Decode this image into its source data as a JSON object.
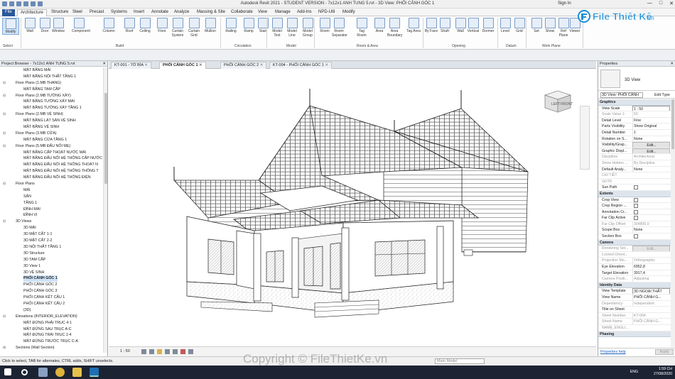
{
  "titlebar": {
    "title": "Autodesk Revit 2021 - STUDENT VERSION - 7x12x1 ANH TUNG 5.rvt - 3D View: PHỐI CẢNH GÓC 1",
    "sign_in": "Sign In"
  },
  "ribbon_tabs": [
    "File",
    "Architecture",
    "Structure",
    "Steel",
    "Precast",
    "Systems",
    "Insert",
    "Annotate",
    "Analyze",
    "Massing & Site",
    "Collaborate",
    "View",
    "Manage",
    "Add-Ins",
    "NPD-Util",
    "Modify"
  ],
  "ribbon": {
    "buttons": [
      "Modify",
      "Wall",
      "Door",
      "Window",
      "Component",
      "Column",
      "Roof",
      "Ceiling",
      "Floor",
      "Curtain System",
      "Curtain Grid",
      "Mullion",
      "Railing",
      "Ramp",
      "Stair",
      "Model Text",
      "Model Line",
      "Model Group",
      "Room",
      "Room Separator",
      "Tag Room",
      "Area",
      "Area Boundary",
      "Tag Area",
      "By Face",
      "Shaft",
      "Wall",
      "Vertical",
      "Dormer",
      "Level",
      "Grid",
      "Set",
      "Show",
      "Ref Plane",
      "Viewer"
    ],
    "groups": [
      "Select",
      "Build",
      "Circulation",
      "Model",
      "Room & Area",
      "Opening",
      "Datum",
      "Work Plane"
    ]
  },
  "project_browser": {
    "title": "Project Browser - 7x12x1 ANH TUNG 5.rvt",
    "items": [
      {
        "label": "MẶT BẰNG MÁI",
        "level": 2
      },
      {
        "label": "MẶT BẰNG NỘI THẤT TẦNG 1",
        "level": 2
      },
      {
        "label": "Floor Plans (1.MB THANG)",
        "level": 1,
        "toggle": "⊟"
      },
      {
        "label": "MẶT BẰNG TAM CẤP",
        "level": 2
      },
      {
        "label": "Floor Plans (2.MB TƯỜNG XÂY)",
        "level": 1,
        "toggle": "⊟"
      },
      {
        "label": "MẶT BẰNG TƯỜNG XÂY MÁI",
        "level": 2
      },
      {
        "label": "MẶT BẰNG TƯỜNG XÂY TẦNG 1",
        "level": 2
      },
      {
        "label": "Floor Plans (2.MB VỆ SINH)",
        "level": 1,
        "toggle": "⊟"
      },
      {
        "label": "MẶT BẰNG LÁT SÀN VỆ SINH",
        "level": 2
      },
      {
        "label": "MẶT BẰNG VỆ SINH",
        "level": 2
      },
      {
        "label": "Floor Plans (3.MB CỬA)",
        "level": 1,
        "toggle": "⊟"
      },
      {
        "label": "MẶT BẰNG CỬA TẦNG 1",
        "level": 2
      },
      {
        "label": "Floor Plans (5.MB ĐẤU NỐI ME)",
        "level": 1,
        "toggle": "⊟"
      },
      {
        "label": "MẶT BẰNG CẤP THOÁT NƯỚC MÁI",
        "level": 2
      },
      {
        "label": "MẶT BẰNG ĐẤU NỐI HỆ THỐNG CẤP NƯỚC",
        "level": 2
      },
      {
        "label": "MẶT BẰNG ĐẤU NỐI HỆ THỐNG THOÁT N",
        "level": 2
      },
      {
        "label": "MẶT BẰNG ĐẤU NỐI HỆ THỐNG THÔNG T",
        "level": 2
      },
      {
        "label": "MẶT BẰNG ĐẤU NỐI HỆ THỐNG ĐIỆN",
        "level": 2
      },
      {
        "label": "Floor Plans",
        "level": 1,
        "toggle": "⊟"
      },
      {
        "label": "MÁI",
        "level": 2
      },
      {
        "label": "SÂN",
        "level": 2
      },
      {
        "label": "TẦNG 1",
        "level": 2
      },
      {
        "label": "ĐỈNH MÁI",
        "level": 2
      },
      {
        "label": "ĐỈNH VỊ",
        "level": 2
      },
      {
        "label": "3D Views",
        "level": 1,
        "toggle": "⊟"
      },
      {
        "label": "3D MÁI",
        "level": 2
      },
      {
        "label": "3D MẶT CẮT 1-1",
        "level": 2
      },
      {
        "label": "3D MẶT CẮT 2-2",
        "level": 2
      },
      {
        "label": "3D NỘI THẤT TẦNG 1",
        "level": 2
      },
      {
        "label": "3D Structure",
        "level": 2
      },
      {
        "label": "3D TAM CẤP",
        "level": 2
      },
      {
        "label": "3D View 1",
        "level": 2
      },
      {
        "label": "3D VỆ SINH",
        "level": 2
      },
      {
        "label": "PHỐI CẢNH GÓC 1",
        "level": 2,
        "selected": true
      },
      {
        "label": "PHỐI CẢNH GÓC 2",
        "level": 2
      },
      {
        "label": "PHỐI CẢNH GÓC 3",
        "level": 2
      },
      {
        "label": "PHỐI CẢNH KẾT CẤU 1",
        "level": 2
      },
      {
        "label": "PHỐI CẢNH KẾT CẤU 2",
        "level": 2
      },
      {
        "label": "{3D}",
        "level": 2
      },
      {
        "label": "Elevations (INTERIOR_ELEVATION)",
        "level": 1,
        "toggle": "⊟"
      },
      {
        "label": "MẶT ĐỨNG PHẢI TRỤC 4-1",
        "level": 2
      },
      {
        "label": "MẶT ĐỨNG SAU TRỤC A-C",
        "level": 2
      },
      {
        "label": "MẶT ĐỨNG TRÁI TRỤC 1-4",
        "level": 2
      },
      {
        "label": "MẶT ĐỨNG TRƯỚC TRỤC C-A",
        "level": 2
      },
      {
        "label": "Sections (Wall Section)",
        "level": 1,
        "toggle": "⊞"
      }
    ]
  },
  "view_tabs": [
    {
      "label": "KT-001 - TỜ BÌA",
      "active": false
    },
    {
      "label": "PHỐI CẢNH GÓC 1",
      "active": true
    },
    {
      "label": "PHỐI CẢNH GÓC 2",
      "active": false
    },
    {
      "label": "KT-004 - PHỐI CẢNH GÓC 1",
      "active": false
    }
  ],
  "view_control": {
    "scale": "1 : 50"
  },
  "properties": {
    "title": "Properties",
    "type_name": "3D View",
    "selector": "3D View: PHỐI CẢNH",
    "edit_type": "Edit Type",
    "rows": [
      {
        "section": "Graphics"
      },
      {
        "k": "View Scale",
        "v": "1 : 50",
        "style": "box"
      },
      {
        "k": "Scale Value 1:",
        "v": "50",
        "dim": true
      },
      {
        "k": "Detail Level",
        "v": "Fine"
      },
      {
        "k": "Parts Visibility",
        "v": "Show Original"
      },
      {
        "k": "Detail Number",
        "v": "1"
      },
      {
        "k": "Rotation on S...",
        "v": "None"
      },
      {
        "k": "Visibility/Grap...",
        "v": "Edit...",
        "style": "btn"
      },
      {
        "k": "Graphic Displ...",
        "v": "Edit...",
        "style": "btn"
      },
      {
        "k": "Discipline",
        "v": "Architectural",
        "dim": true
      },
      {
        "k": "Show Hidden ...",
        "v": "By Discipline",
        "dim": true
      },
      {
        "k": "Default Analy...",
        "v": "None"
      },
      {
        "k": "CHI TIẾT",
        "v": "",
        "dim": true
      },
      {
        "k": "GDTK",
        "v": "",
        "dim": true
      },
      {
        "k": "Sun Path",
        "check": true
      },
      {
        "section": "Extents"
      },
      {
        "k": "Crop View",
        "check": true
      },
      {
        "k": "Crop Region ...",
        "check": true
      },
      {
        "k": "Annotation Cr...",
        "check": true
      },
      {
        "k": "Far Clip Active",
        "check": true
      },
      {
        "k": "Far Clip Offset",
        "v": "304800,0",
        "dim": true
      },
      {
        "k": "Scope Box",
        "v": "None"
      },
      {
        "k": "Section Box",
        "check": true
      },
      {
        "section": "Camera"
      },
      {
        "k": "Rendering Set...",
        "v": "Edit...",
        "style": "btn",
        "dim": true
      },
      {
        "k": "Locked Orient...",
        "v": "",
        "dim": true
      },
      {
        "k": "Projection Mo...",
        "v": "Orthographic",
        "dim": true
      },
      {
        "k": "Eye Elevation",
        "v": "6952,8"
      },
      {
        "k": "Target Elevation",
        "v": "3917,4"
      },
      {
        "k": "Camera Positi...",
        "v": "Adjusting",
        "dim": true
      },
      {
        "section": "Identity Data"
      },
      {
        "k": "View Template",
        "v": "3D NGOẠI THẤT",
        "style": "box"
      },
      {
        "k": "View Name",
        "v": "PHỐI CẢNH G..."
      },
      {
        "k": "Dependency",
        "v": "Independent",
        "dim": true
      },
      {
        "k": "Title on Sheet",
        "v": ""
      },
      {
        "k": "Sheet Number",
        "v": "KT-004",
        "dim": true
      },
      {
        "k": "Sheet Name",
        "v": "PHỐI CẢNH G...",
        "dim": true
      },
      {
        "k": "NAME_ENGLI...",
        "v": "",
        "dim": true
      },
      {
        "section": "Phasing"
      }
    ],
    "help_link": "Properties help",
    "apply": "Apply"
  },
  "status": {
    "text": "Click to select, TAB for alternates, CTRL adds, SHIFT unselects.",
    "model": "Main Model"
  },
  "taskbar": {
    "time": "1:59 CH",
    "date": "27/08/2020",
    "lang": "ENG"
  },
  "brand": {
    "logo": "File Thiết Kế",
    "logo_suffix": ".vn",
    "watermark": "Copyright © FileThietKe.vn"
  },
  "colors": {
    "accent": "#2b579a",
    "brand": "#1a90d6"
  }
}
